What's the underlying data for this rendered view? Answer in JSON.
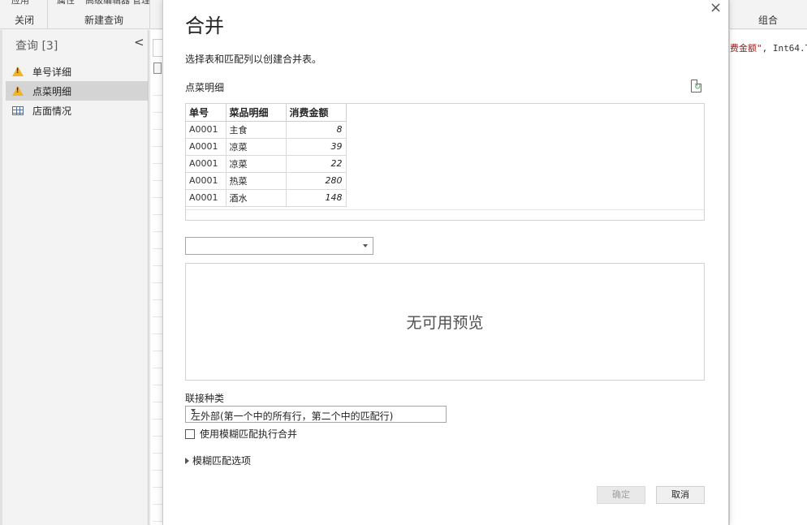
{
  "ribbon": {
    "cut_labels": [
      "应用",
      "属性",
      "高级编辑器",
      "管理"
    ],
    "close_label": "关闭",
    "new_query_label": "新建查询",
    "combine_label": "组合"
  },
  "queries": {
    "title": "查询 [3]",
    "items": [
      {
        "label": "单号详细",
        "icon": "warning-icon"
      },
      {
        "label": "点菜明细",
        "icon": "warning-icon",
        "selected": true
      },
      {
        "label": "店面情况",
        "icon": "table-icon"
      }
    ]
  },
  "formula": {
    "string_part": "费金额\"",
    "rest": ", Int64.T"
  },
  "dialog": {
    "title": "合并",
    "description": "选择表和匹配列以创建合并表。",
    "table_label": "点菜明细",
    "preview_table": {
      "columns": [
        "单号",
        "菜品明细",
        "消费金额"
      ],
      "rows": [
        [
          "A0001",
          "主食",
          "8"
        ],
        [
          "A0001",
          "凉菜",
          "39"
        ],
        [
          "A0001",
          "凉菜",
          "22"
        ],
        [
          "A0001",
          "热菜",
          "280"
        ],
        [
          "A0001",
          "酒水",
          "148"
        ]
      ]
    },
    "second_table_value": "",
    "no_preview": "无可用预览",
    "join_kind_label": "联接种类",
    "join_kind_value": "左外部(第一个中的所有行，第二个中的匹配行)",
    "fuzzy_checkbox_label": "使用模糊匹配执行合并",
    "fuzzy_options_label": "模糊匹配选项",
    "ok_label": "确定",
    "cancel_label": "取消",
    "close_symbol": "×"
  },
  "colors": {
    "warning": "#f2b329",
    "selected_bg": "#d4d4d4",
    "formula_string": "#a31515"
  }
}
